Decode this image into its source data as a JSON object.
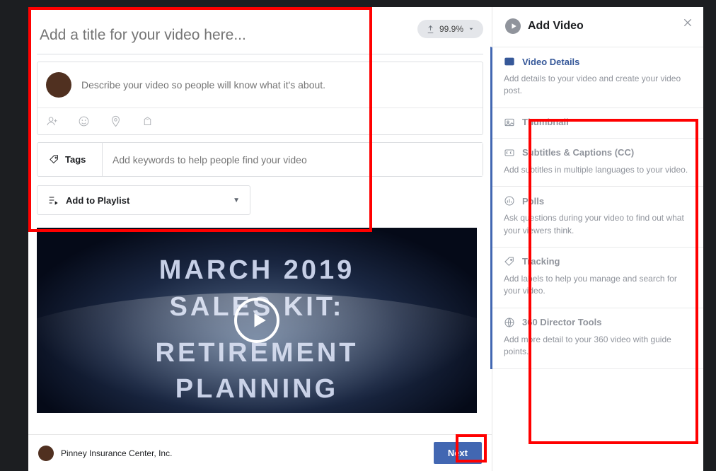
{
  "header": {
    "title_placeholder": "Add a title for your video here...",
    "upload_progress": "99.9%"
  },
  "describe": {
    "placeholder": "Describe your video so people will know what it's about."
  },
  "tags": {
    "label": "Tags",
    "placeholder": "Add keywords to help people find your video"
  },
  "playlist": {
    "label": "Add to Playlist"
  },
  "video": {
    "line1": "MARCH 2019",
    "line2": "SALES KIT:",
    "line3": "RETIREMENT",
    "line4": "PLANNING"
  },
  "footer": {
    "page_name": "Pinney Insurance Center, Inc.",
    "next": "Next"
  },
  "sidebar": {
    "title": "Add Video",
    "items": [
      {
        "title": "Video Details",
        "desc": "Add details to your video and create your video post."
      },
      {
        "title": "Thumbnail",
        "desc": ""
      },
      {
        "title": "Subtitles & Captions (CC)",
        "desc": "Add subtitles in multiple languages to your video."
      },
      {
        "title": "Polls",
        "desc": "Ask questions during your video to find out what your viewers think."
      },
      {
        "title": "Tracking",
        "desc": "Add labels to help you manage and search for your video."
      },
      {
        "title": "360 Director Tools",
        "desc": "Add more detail to your 360 video with guide points."
      }
    ]
  }
}
